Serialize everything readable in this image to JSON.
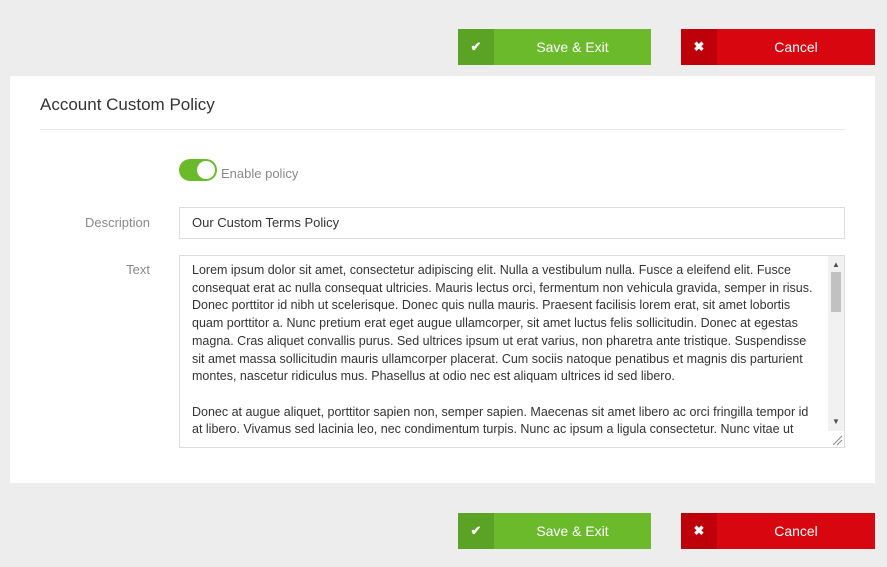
{
  "buttons": {
    "save_label": "Save & Exit",
    "cancel_label": "Cancel",
    "save_icon": "check-icon",
    "cancel_icon": "x-icon"
  },
  "panel": {
    "title": "Account Custom Policy",
    "toggle": {
      "label": "Enable policy",
      "enabled": true
    },
    "description": {
      "label": "Description",
      "value": "Our Custom Terms Policy"
    },
    "text": {
      "label": "Text",
      "value": "Lorem ipsum dolor sit amet, consectetur adipiscing elit. Nulla a vestibulum nulla. Fusce a eleifend elit. Fusce consequat erat ac nulla consequat ultricies. Mauris lectus orci, fermentum non vehicula gravida, semper in risus. Donec porttitor id nibh ut scelerisque. Donec quis nulla mauris. Praesent facilisis lorem erat, sit amet lobortis quam porttitor a. Nunc pretium erat eget augue ullamcorper, sit amet luctus felis sollicitudin. Donec at egestas magna. Cras aliquet convallis purus. Sed ultrices ipsum ut erat varius, non pharetra ante tristique. Suspendisse sit amet massa sollicitudin mauris ullamcorper placerat. Cum sociis natoque penatibus et magnis dis parturient montes, nascetur ridiculus mus. Phasellus at odio nec est aliquam ultrices id sed libero.\n\nDonec at augue aliquet, porttitor sapien non, semper sapien. Maecenas sit amet libero ac orci fringilla tempor id at libero. Vivamus sed lacinia leo, nec condimentum turpis. Nunc ac ipsum a ligula consectetur. Nunc vitae ut"
    }
  },
  "colors": {
    "save": "#6aba2c",
    "cancel": "#d7060f",
    "toggle_on": "#6aba2c"
  }
}
